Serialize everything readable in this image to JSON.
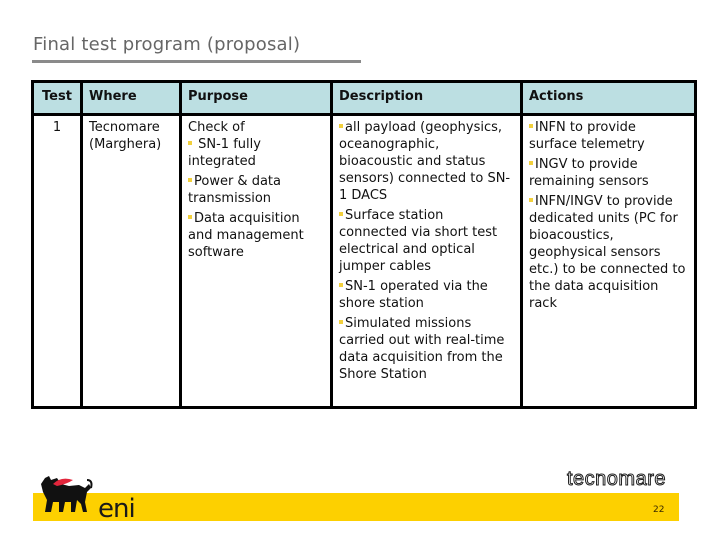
{
  "slide": {
    "title": "Final test program (proposal)",
    "page_number": "22"
  },
  "table": {
    "headers": {
      "test": "Test",
      "where": "Where",
      "purpose": "Purpose",
      "description": "Description",
      "actions": "Actions"
    },
    "rows": [
      {
        "test": "1",
        "where": "Tecnomare (Marghera)",
        "purpose_intro": "Check of",
        "purpose_items": [
          " SN-1 fully integrated",
          "Power & data transmission",
          "Data acquisition and management software"
        ],
        "description_items": [
          "all payload (geophysics, oceanographic, bioacoustic and status sensors) connected to SN-1 DACS",
          "Surface station connected via short test electrical and optical jumper cables",
          "SN-1 operated via the shore station",
          "Simulated missions carried out with real-time data acquisition from the Shore Station"
        ],
        "actions_items": [
          "INFN to provide surface telemetry",
          "INGV to provide remaining sensors",
          "INFN/INGV to provide dedicated units (PC for bioacoustics, geophysical sensors etc.) to be connected to the data acquisition rack"
        ]
      }
    ]
  },
  "footer": {
    "left_logo_text": "eni",
    "right_logo_text": "tecnomare",
    "band_color": "#fdd000",
    "bullet_color": "#f2d03c",
    "header_bg_color": "#bcdfe2"
  }
}
